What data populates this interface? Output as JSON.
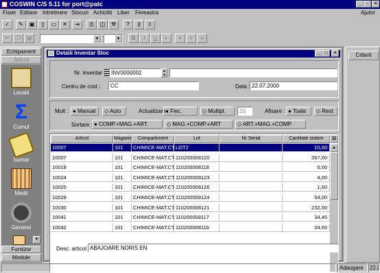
{
  "app": {
    "title": "COSWIN C/S 5.11 for port@patc"
  },
  "menu": [
    "Fisier",
    "Editare",
    "Intretinere",
    "Stocuri",
    "Achizitii",
    "Liber",
    "Fereastra"
  ],
  "help": "Ajutor",
  "left": {
    "header_top": "Echipament",
    "header_sub": "Articol",
    "items": [
      {
        "label": "Locatii",
        "icon": "folder-icon"
      },
      {
        "label": "Cumul",
        "icon": "sigma-icon"
      },
      {
        "label": "Sumar",
        "icon": "clipboard-icon"
      },
      {
        "label": "Medii",
        "icon": "chart-icon"
      },
      {
        "label": "General",
        "icon": "camera-icon"
      }
    ],
    "footer1": "Furnizor",
    "footer2": "Module"
  },
  "window": {
    "title": "Detalii Inventar Stoc"
  },
  "form": {
    "nr_label": "Nr. inventar :",
    "nr_value": "INV0000002",
    "cc_label": "Centru de cost :",
    "cc_value": "CC",
    "data_label": "Data :",
    "data_value": "22.07.2000"
  },
  "options": {
    "mult_label": "Mult :",
    "manual": "Manual",
    "auto": "Auto",
    "actual_label": "Actualizare :",
    "fiec": "Fiec.",
    "multipl": "Multipl.",
    "multipl_value": "10",
    "afis_label": "Afisare :",
    "toate": "Toate",
    "rest": "Rest",
    "sort_label": "Sortare :",
    "sort1": "COMP.+MAG.+ART.",
    "sort2": "MAG.+COMP.+ART",
    "sort3": "ART.+MAG.+COMP."
  },
  "table": {
    "headers": [
      "Articol",
      "Magazie",
      "Compartiment",
      "Lot",
      "Nr Serial",
      "Cantitate sistem"
    ],
    "rows": [
      [
        "10007",
        "101",
        "CHIMICE-MAT.CT",
        "LOT2",
        "",
        "10,00"
      ],
      [
        "10007",
        "101",
        "CHIMICE-MAT.CT",
        "110200008120",
        "",
        "267,00"
      ],
      [
        "10018",
        "101",
        "CHIMICE-MAT.CT",
        "110200008118",
        "",
        "5,00"
      ],
      [
        "10024",
        "101",
        "CHIMICE-MAT.CT",
        "110200008123",
        "",
        "4,00"
      ],
      [
        "10025",
        "101",
        "CHIMICE-MAT.CT",
        "110200008126",
        "",
        "1,00"
      ],
      [
        "10029",
        "101",
        "CHIMICE-MAT.CT",
        "110200008124",
        "",
        "54,00"
      ],
      [
        "10030",
        "101",
        "CHIMICE-MAT.CT",
        "110200008121",
        "",
        "232,00"
      ],
      [
        "10041",
        "101",
        "CHIMICE-MAT.CT",
        "110200008117",
        "",
        "34,45"
      ],
      [
        "10042",
        "101",
        "CHIMICE-MAT.CT",
        "110200008116",
        "",
        "24,00"
      ]
    ]
  },
  "desc": {
    "label": "Desc. articol :",
    "value": "ABAJOARE NORIS EN"
  },
  "right": {
    "button": "Criterii"
  },
  "status": {
    "mode": "Adaugare",
    "extra": "22.0"
  }
}
